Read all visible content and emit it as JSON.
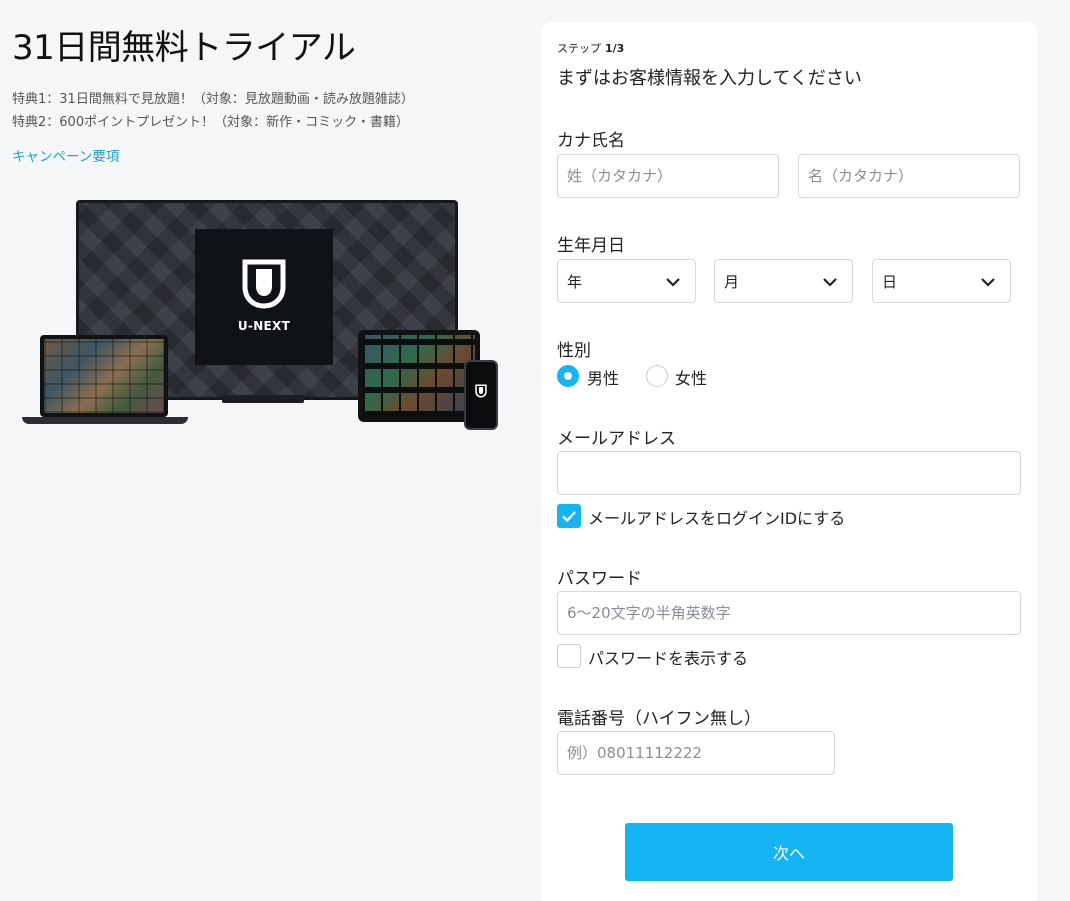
{
  "promo": {
    "title": "31日間無料トライアル",
    "perk1": "特典1：31日間無料で見放題！（対象：見放題動画・読み放題雑誌）",
    "perk2": "特典2：600ポイントプレゼント！（対象：新作・コミック・書籍）",
    "campaign_link": "キャンペーン要項",
    "brand_logo_text": "U-NEXT"
  },
  "form": {
    "step_label": "ステップ",
    "step_value": "1/3",
    "heading": "まずはお客様情報を入力してください",
    "kana_label": "カナ氏名",
    "kana_last_placeholder": "姓（カタカナ）",
    "kana_first_placeholder": "名（カタカナ）",
    "birth_label": "生年月日",
    "birth_year": "年",
    "birth_month": "月",
    "birth_day": "日",
    "gender_label": "性別",
    "gender_male": "男性",
    "gender_female": "女性",
    "gender_selected": "男性",
    "email_label": "メールアドレス",
    "email_value": "",
    "email_as_login_label": "メールアドレスをログインIDにする",
    "email_as_login_checked": true,
    "password_label": "パスワード",
    "password_placeholder": "6〜20文字の半角英数字",
    "show_password_label": "パスワードを表示する",
    "show_password_checked": false,
    "phone_label": "電話番号（ハイフン無し）",
    "phone_placeholder": "例）08011112222",
    "next_button": "次へ"
  },
  "colors": {
    "accent": "#14b5f2",
    "link": "#1aa3d6",
    "background": "#f5f6f8"
  }
}
